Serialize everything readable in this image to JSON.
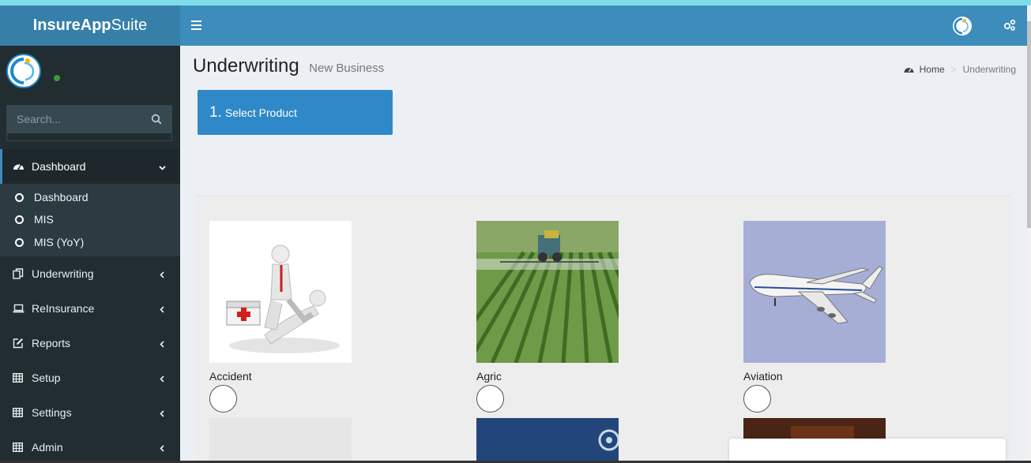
{
  "app": {
    "brand_bold": "InsureApp",
    "brand_light": "Suite"
  },
  "sidebar": {
    "search_placeholder": "Search...",
    "menu": [
      {
        "label": "Dashboard",
        "icon": "dashboard-icon",
        "active": true
      },
      {
        "label": "Underwriting",
        "icon": "copy-icon"
      },
      {
        "label": "ReInsurance",
        "icon": "laptop-icon"
      },
      {
        "label": "Reports",
        "icon": "edit-icon"
      },
      {
        "label": "Setup",
        "icon": "table-icon"
      },
      {
        "label": "Settings",
        "icon": "table-icon"
      },
      {
        "label": "Admin",
        "icon": "table-icon"
      }
    ],
    "dashboard_sub": [
      "Dashboard",
      "MIS",
      "MIS (YoY)"
    ]
  },
  "header": {
    "title": "Underwriting",
    "subtitle": "New Business"
  },
  "breadcrumb": {
    "home": "Home",
    "current": "Underwriting"
  },
  "wizard": {
    "step_number": "1.",
    "step_label": "Select Product"
  },
  "products": [
    {
      "name": "Accident",
      "image": "first-aid-figure-image"
    },
    {
      "name": "Agric",
      "image": "crop-field-tractor-image"
    },
    {
      "name": "Aviation",
      "image": "airplane-image"
    }
  ],
  "colors": {
    "navbar": "#3c8dbc",
    "sidebar": "#222d32",
    "step_box": "#2f89c8"
  }
}
